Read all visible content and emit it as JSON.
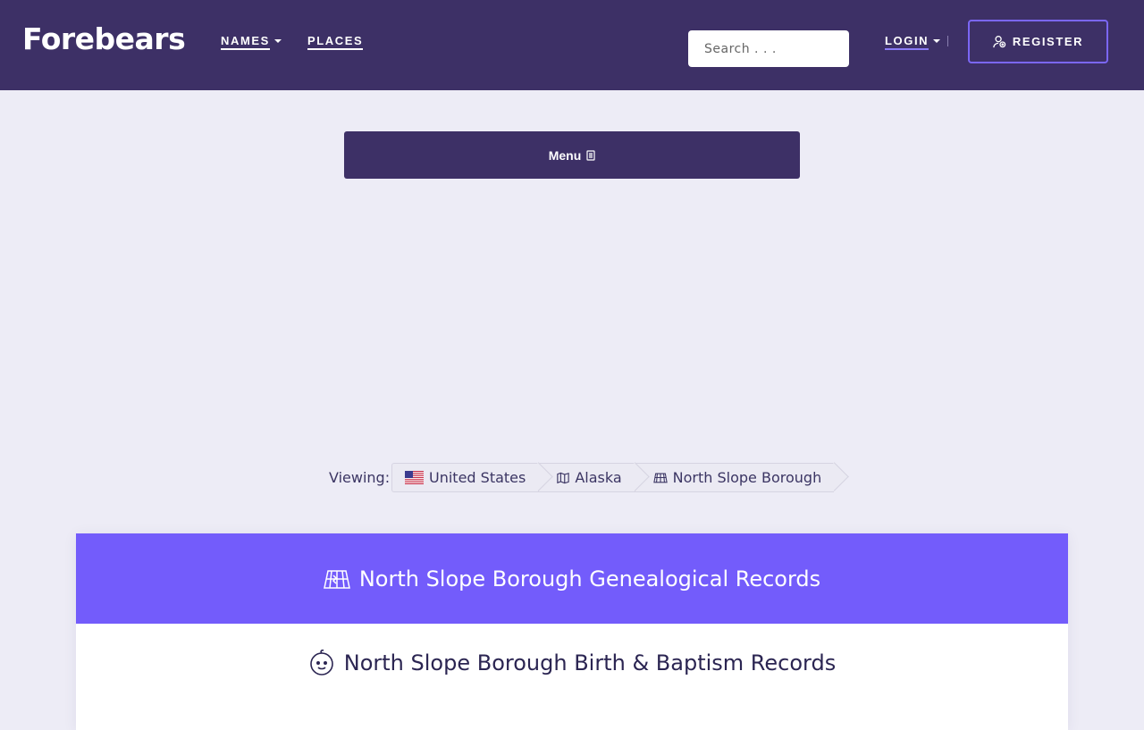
{
  "header": {
    "logo": "Forebears",
    "nav": [
      {
        "label": "NAMES",
        "has_dropdown": true
      },
      {
        "label": "PLACES",
        "has_dropdown": false
      }
    ],
    "search": {
      "placeholder": "Search . . ."
    },
    "login": {
      "label": "LOGIN"
    },
    "register": {
      "label": "REGISTER"
    }
  },
  "menu_button": {
    "label": "Menu"
  },
  "breadcrumb": {
    "prefix": "Viewing:",
    "items": [
      {
        "label": "United States",
        "icon": "us-flag-icon"
      },
      {
        "label": "Alaska",
        "icon": "map-icon"
      },
      {
        "label": "North Slope Borough",
        "icon": "region-map-icon"
      }
    ]
  },
  "card": {
    "heading": "North Slope Borough Genealogical Records",
    "section_title": "North Slope Borough Birth & Baptism Records"
  },
  "colors": {
    "header_bg": "#3d3066",
    "accent": "#735cfb",
    "page_bg": "#edecf6"
  }
}
